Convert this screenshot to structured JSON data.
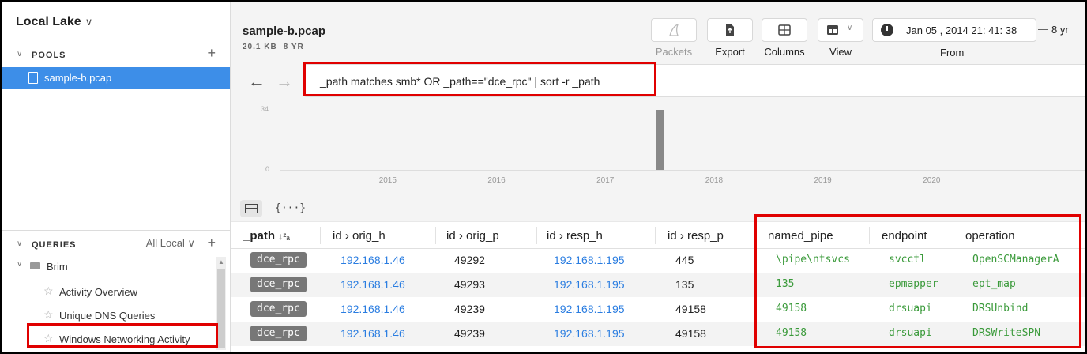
{
  "sidebar": {
    "lake_title": "Local Lake",
    "pools_label": "POOLS",
    "pool_item": "sample-b.pcap",
    "queries_label": "QUERIES",
    "queries_scope": "All Local",
    "folder": "Brim",
    "queries": [
      "Activity Overview",
      "Unique DNS Queries",
      "Windows Networking Activity"
    ]
  },
  "header": {
    "file_name": "sample-b.pcap",
    "size": "20.1 KB",
    "age": "8 YR"
  },
  "toolbar": {
    "packets": "Packets",
    "export": "Export",
    "columns": "Columns",
    "view": "View",
    "from_date": "Jan 05 , 2014  21: 41: 38",
    "from_label": "From",
    "span": "8 yr"
  },
  "search": {
    "query": "_path matches smb* OR _path==\"dce_rpc\" | sort -r _path"
  },
  "chart_data": {
    "type": "bar",
    "ylim": [
      0,
      34
    ],
    "yticks": [
      "34",
      "0"
    ],
    "x_ticks": [
      "2015",
      "2016",
      "2017",
      "2018",
      "2019",
      "2020"
    ],
    "x_range": [
      2014.0,
      2021.4
    ],
    "bars": [
      {
        "x": 2017.5,
        "value": 34
      }
    ],
    "grid": false
  },
  "table": {
    "columns": [
      "_path",
      "id › orig_h",
      "id › orig_p",
      "id › resp_h",
      "id › resp_p",
      "named_pipe",
      "endpoint",
      "operation"
    ],
    "sort_indicator": "↓z A",
    "rows": [
      {
        "path": "dce_rpc",
        "orig_h": "192.168.1.46",
        "orig_p": "49292",
        "resp_h": "192.168.1.195",
        "resp_p": "445",
        "named_pipe": "\\pipe\\ntsvcs",
        "endpoint": "svcctl",
        "operation": "OpenSCManagerA"
      },
      {
        "path": "dce_rpc",
        "orig_h": "192.168.1.46",
        "orig_p": "49293",
        "resp_h": "192.168.1.195",
        "resp_p": "135",
        "named_pipe": "135",
        "endpoint": "epmapper",
        "operation": "ept_map"
      },
      {
        "path": "dce_rpc",
        "orig_h": "192.168.1.46",
        "orig_p": "49239",
        "resp_h": "192.168.1.195",
        "resp_p": "49158",
        "named_pipe": "49158",
        "endpoint": "drsuapi",
        "operation": "DRSUnbind"
      },
      {
        "path": "dce_rpc",
        "orig_h": "192.168.1.46",
        "orig_p": "49239",
        "resp_h": "192.168.1.195",
        "resp_p": "49158",
        "named_pipe": "49158",
        "endpoint": "drsuapi",
        "operation": "DRSWriteSPN"
      }
    ]
  },
  "colors": {
    "accent": "#3d8ee8",
    "highlight": "#e00000",
    "ip_link": "#2a7de1",
    "green_text": "#3a9a3a"
  }
}
